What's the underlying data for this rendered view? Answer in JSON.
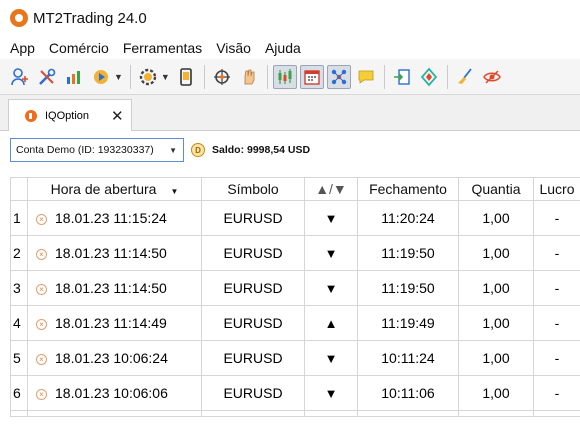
{
  "app": {
    "title": "MT2Trading 24.0",
    "brand_color": "#e8761c"
  },
  "menu": [
    {
      "label": "App"
    },
    {
      "label": "Comércio"
    },
    {
      "label": "Ferramentas"
    },
    {
      "label": "Visão"
    },
    {
      "label": "Ajuda"
    }
  ],
  "toolbar": {
    "icons": [
      "add-user-icon",
      "tools-icon",
      "stats-chart-icon",
      "media-play-icon",
      "settings-coin-icon",
      "mobile-device-icon",
      "target-icon",
      "hand-icon",
      "bar-chart-icon",
      "calendar-icon",
      "network-icon",
      "chat-bubble-icon",
      "export-icon",
      "diamond-icon",
      "broom-icon",
      "hide-icon"
    ]
  },
  "tab": {
    "label": "IQOption"
  },
  "account": {
    "selected": "Conta Demo (ID: 193230337)",
    "balance_icon": "D",
    "balance_label": "Saldo: 9998,54 USD"
  },
  "table": {
    "columns": [
      "Hora de abertura",
      "Símbolo",
      "▲/▼",
      "Fechamento",
      "Quantia",
      "Lucro"
    ],
    "rows": [
      {
        "num": "1",
        "open": "18.01.23 11:15:24",
        "symbol": "EURUSD",
        "dir": "▼",
        "close": "11:20:24",
        "amount": "1,00",
        "profit": "-"
      },
      {
        "num": "2",
        "open": "18.01.23 11:14:50",
        "symbol": "EURUSD",
        "dir": "▼",
        "close": "11:19:50",
        "amount": "1,00",
        "profit": "-"
      },
      {
        "num": "3",
        "open": "18.01.23 11:14:50",
        "symbol": "EURUSD",
        "dir": "▼",
        "close": "11:19:50",
        "amount": "1,00",
        "profit": "-"
      },
      {
        "num": "4",
        "open": "18.01.23 11:14:49",
        "symbol": "EURUSD",
        "dir": "▲",
        "close": "11:19:49",
        "amount": "1,00",
        "profit": "-"
      },
      {
        "num": "5",
        "open": "18.01.23 10:06:24",
        "symbol": "EURUSD",
        "dir": "▼",
        "close": "10:11:24",
        "amount": "1,00",
        "profit": "-"
      },
      {
        "num": "6",
        "open": "18.01.23 10:06:06",
        "symbol": "EURUSD",
        "dir": "▼",
        "close": "10:11:06",
        "amount": "1,00",
        "profit": "-"
      }
    ]
  }
}
